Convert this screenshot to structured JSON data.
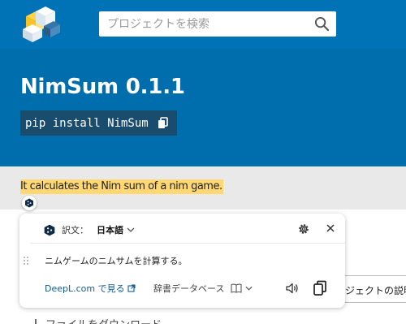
{
  "header": {
    "search_placeholder": "プロジェクトを検索"
  },
  "banner": {
    "title": "NimSum 0.1.1",
    "pip_command": "pip install NimSum"
  },
  "description": {
    "text": "It calculates the Nim sum of a nim game."
  },
  "translator": {
    "label": "訳文：",
    "language": "日本語",
    "translation": "ニムゲームのニムサムを計算する。",
    "deepl_link": "DeepL.com で見る",
    "dictionary": "辞書データベース"
  },
  "behind": {
    "tab_label": "ジェクトの説明",
    "download_link": "ファイルをダウンロード"
  },
  "colors": {
    "header_bg": "#0073b7",
    "banner_bg": "#006dad",
    "highlight": "#ffd874",
    "link": "#0f5c9e"
  }
}
